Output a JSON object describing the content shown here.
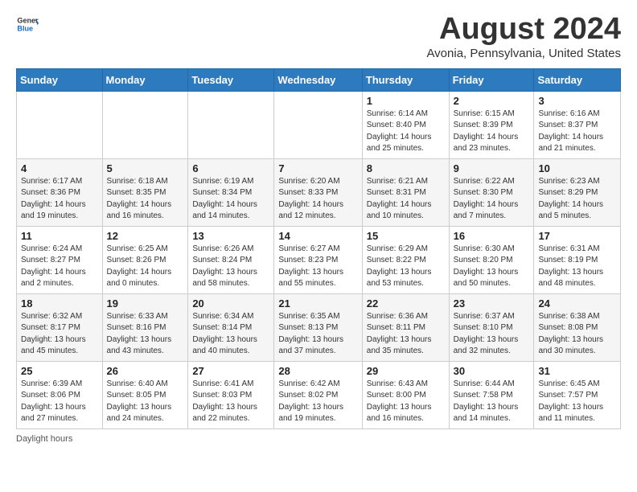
{
  "header": {
    "logo_general": "General",
    "logo_blue": "Blue",
    "month_year": "August 2024",
    "location": "Avonia, Pennsylvania, United States"
  },
  "days_of_week": [
    "Sunday",
    "Monday",
    "Tuesday",
    "Wednesday",
    "Thursday",
    "Friday",
    "Saturday"
  ],
  "weeks": [
    [
      {
        "day": "",
        "info": ""
      },
      {
        "day": "",
        "info": ""
      },
      {
        "day": "",
        "info": ""
      },
      {
        "day": "",
        "info": ""
      },
      {
        "day": "1",
        "info": "Sunrise: 6:14 AM\nSunset: 8:40 PM\nDaylight: 14 hours\nand 25 minutes."
      },
      {
        "day": "2",
        "info": "Sunrise: 6:15 AM\nSunset: 8:39 PM\nDaylight: 14 hours\nand 23 minutes."
      },
      {
        "day": "3",
        "info": "Sunrise: 6:16 AM\nSunset: 8:37 PM\nDaylight: 14 hours\nand 21 minutes."
      }
    ],
    [
      {
        "day": "4",
        "info": "Sunrise: 6:17 AM\nSunset: 8:36 PM\nDaylight: 14 hours\nand 19 minutes."
      },
      {
        "day": "5",
        "info": "Sunrise: 6:18 AM\nSunset: 8:35 PM\nDaylight: 14 hours\nand 16 minutes."
      },
      {
        "day": "6",
        "info": "Sunrise: 6:19 AM\nSunset: 8:34 PM\nDaylight: 14 hours\nand 14 minutes."
      },
      {
        "day": "7",
        "info": "Sunrise: 6:20 AM\nSunset: 8:33 PM\nDaylight: 14 hours\nand 12 minutes."
      },
      {
        "day": "8",
        "info": "Sunrise: 6:21 AM\nSunset: 8:31 PM\nDaylight: 14 hours\nand 10 minutes."
      },
      {
        "day": "9",
        "info": "Sunrise: 6:22 AM\nSunset: 8:30 PM\nDaylight: 14 hours\nand 7 minutes."
      },
      {
        "day": "10",
        "info": "Sunrise: 6:23 AM\nSunset: 8:29 PM\nDaylight: 14 hours\nand 5 minutes."
      }
    ],
    [
      {
        "day": "11",
        "info": "Sunrise: 6:24 AM\nSunset: 8:27 PM\nDaylight: 14 hours\nand 2 minutes."
      },
      {
        "day": "12",
        "info": "Sunrise: 6:25 AM\nSunset: 8:26 PM\nDaylight: 14 hours\nand 0 minutes."
      },
      {
        "day": "13",
        "info": "Sunrise: 6:26 AM\nSunset: 8:24 PM\nDaylight: 13 hours\nand 58 minutes."
      },
      {
        "day": "14",
        "info": "Sunrise: 6:27 AM\nSunset: 8:23 PM\nDaylight: 13 hours\nand 55 minutes."
      },
      {
        "day": "15",
        "info": "Sunrise: 6:29 AM\nSunset: 8:22 PM\nDaylight: 13 hours\nand 53 minutes."
      },
      {
        "day": "16",
        "info": "Sunrise: 6:30 AM\nSunset: 8:20 PM\nDaylight: 13 hours\nand 50 minutes."
      },
      {
        "day": "17",
        "info": "Sunrise: 6:31 AM\nSunset: 8:19 PM\nDaylight: 13 hours\nand 48 minutes."
      }
    ],
    [
      {
        "day": "18",
        "info": "Sunrise: 6:32 AM\nSunset: 8:17 PM\nDaylight: 13 hours\nand 45 minutes."
      },
      {
        "day": "19",
        "info": "Sunrise: 6:33 AM\nSunset: 8:16 PM\nDaylight: 13 hours\nand 43 minutes."
      },
      {
        "day": "20",
        "info": "Sunrise: 6:34 AM\nSunset: 8:14 PM\nDaylight: 13 hours\nand 40 minutes."
      },
      {
        "day": "21",
        "info": "Sunrise: 6:35 AM\nSunset: 8:13 PM\nDaylight: 13 hours\nand 37 minutes."
      },
      {
        "day": "22",
        "info": "Sunrise: 6:36 AM\nSunset: 8:11 PM\nDaylight: 13 hours\nand 35 minutes."
      },
      {
        "day": "23",
        "info": "Sunrise: 6:37 AM\nSunset: 8:10 PM\nDaylight: 13 hours\nand 32 minutes."
      },
      {
        "day": "24",
        "info": "Sunrise: 6:38 AM\nSunset: 8:08 PM\nDaylight: 13 hours\nand 30 minutes."
      }
    ],
    [
      {
        "day": "25",
        "info": "Sunrise: 6:39 AM\nSunset: 8:06 PM\nDaylight: 13 hours\nand 27 minutes."
      },
      {
        "day": "26",
        "info": "Sunrise: 6:40 AM\nSunset: 8:05 PM\nDaylight: 13 hours\nand 24 minutes."
      },
      {
        "day": "27",
        "info": "Sunrise: 6:41 AM\nSunset: 8:03 PM\nDaylight: 13 hours\nand 22 minutes."
      },
      {
        "day": "28",
        "info": "Sunrise: 6:42 AM\nSunset: 8:02 PM\nDaylight: 13 hours\nand 19 minutes."
      },
      {
        "day": "29",
        "info": "Sunrise: 6:43 AM\nSunset: 8:00 PM\nDaylight: 13 hours\nand 16 minutes."
      },
      {
        "day": "30",
        "info": "Sunrise: 6:44 AM\nSunset: 7:58 PM\nDaylight: 13 hours\nand 14 minutes."
      },
      {
        "day": "31",
        "info": "Sunrise: 6:45 AM\nSunset: 7:57 PM\nDaylight: 13 hours\nand 11 minutes."
      }
    ]
  ],
  "footer": {
    "daylight_label": "Daylight hours"
  }
}
